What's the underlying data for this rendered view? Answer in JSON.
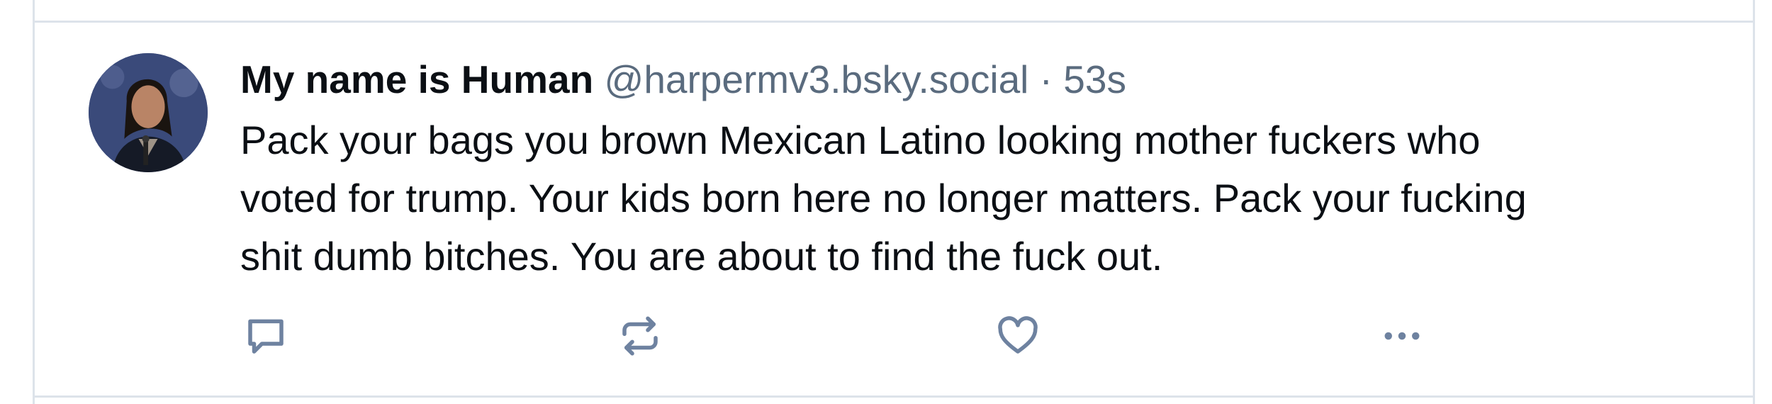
{
  "post": {
    "author": {
      "display_name": "My name is Human",
      "handle": "@harpermv3.bsky.social"
    },
    "separator": "·",
    "timestamp": "53s",
    "text_lines": [
      "Pack your bags you brown Mexican Latino looking mother fuckers who",
      "voted for trump. Your kids born here no longer matters. Pack your fucking",
      "shit dumb bitches. You are about to find the fuck out."
    ],
    "actions": [
      {
        "name": "reply",
        "icon": "speech-bubble-icon"
      },
      {
        "name": "repost",
        "icon": "repost-arrows-icon"
      },
      {
        "name": "like",
        "icon": "heart-icon"
      },
      {
        "name": "more",
        "icon": "ellipsis-icon"
      }
    ]
  },
  "colors": {
    "divider": "#dde3ea",
    "text": "#0b0f14",
    "muted": "#5a6b7e",
    "icon": "#6e82a0"
  }
}
